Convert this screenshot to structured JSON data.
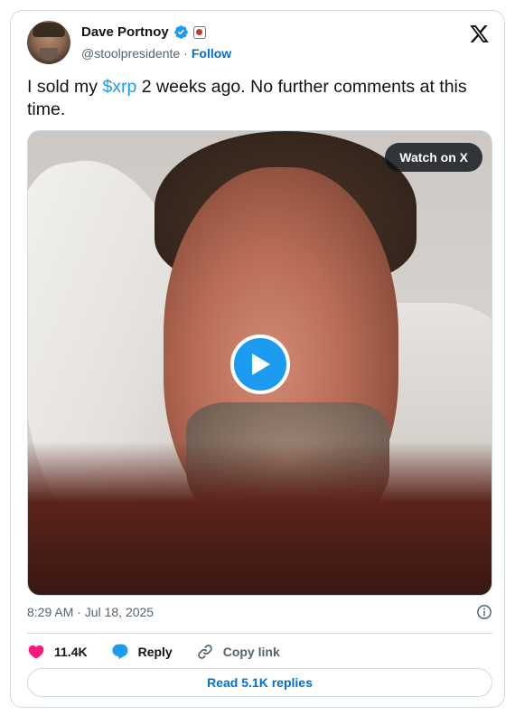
{
  "author": {
    "name": "Dave Portnoy",
    "handle": "@stoolpresidente",
    "separator": "·",
    "follow_label": "Follow",
    "verified_color": "#1d9bf0"
  },
  "tweet": {
    "text_before": "I sold my ",
    "cashtag": "$xrp",
    "text_after": " 2 weeks ago.  No further comments at this time."
  },
  "media": {
    "watch_label": "Watch on X",
    "play_icon": "play-icon"
  },
  "meta": {
    "timestamp": "8:29 AM · Jul 18, 2025"
  },
  "actions": {
    "likes": "11.4K",
    "reply_label": "Reply",
    "copy_label": "Copy link"
  },
  "footer": {
    "read_replies_label": "Read 5.1K replies"
  },
  "colors": {
    "accent": "#1d9bf0",
    "link": "#006fd6",
    "like": "#f91880",
    "muted": "#536471"
  }
}
